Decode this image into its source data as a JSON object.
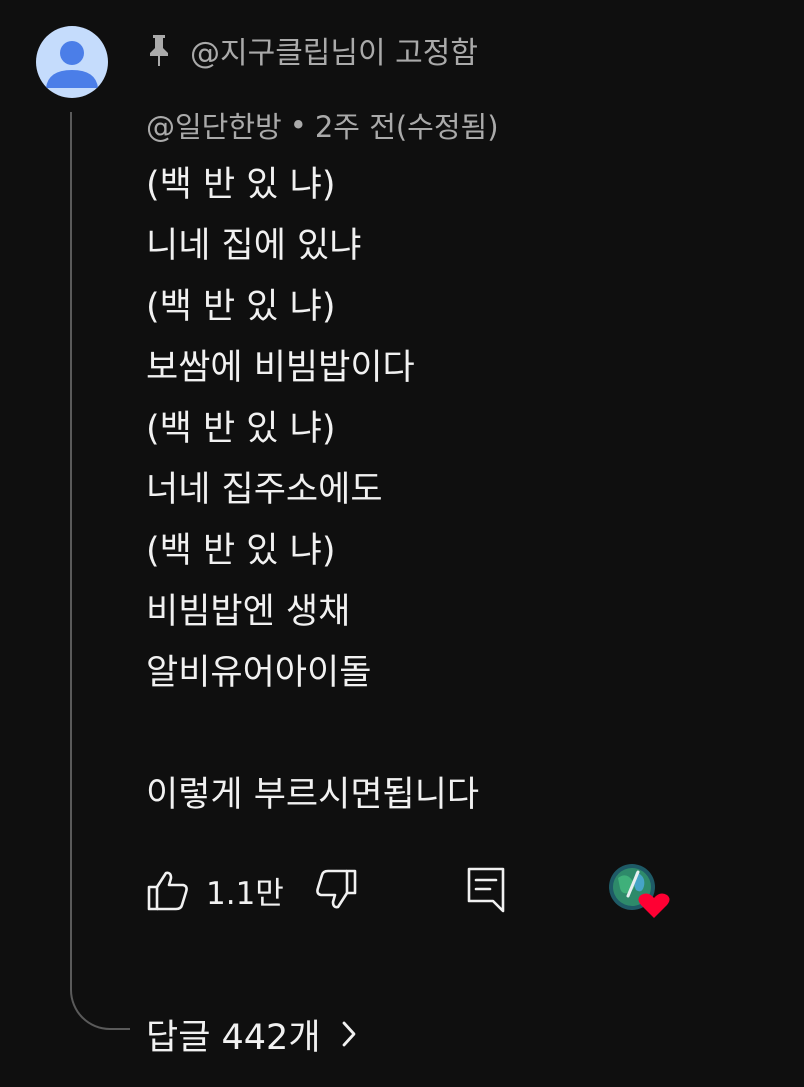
{
  "pinned": {
    "icon": "pin-icon",
    "text": "@지구클립님이 고정함"
  },
  "comment": {
    "author": "@일단한방",
    "separator": "•",
    "time": "2주 전(수정됨)",
    "lines": [
      "(백 반 있 냐)",
      "니네 집에 있냐",
      "(백 반 있 냐)",
      "보쌈에 비빔밥이다",
      "(백 반 있 냐)",
      "너네 집주소에도",
      "(백 반 있 냐)",
      "비빔밥엔 생채",
      "알비유어아이돌",
      "",
      "이렇게 부르시면됩니다"
    ]
  },
  "actions": {
    "like_icon": "thumbs-up-icon",
    "like_count": "1.1만",
    "dislike_icon": "thumbs-down-icon",
    "reply_icon": "reply-comment-icon",
    "creator_heart": "creator-heart-badge"
  },
  "replies": {
    "label": "답글 442개",
    "icon": "chevron-right-icon"
  },
  "colors": {
    "background": "#0f0f0f",
    "text": "#f1f1f1",
    "meta": "#aaaaaa",
    "heart": "#ff0033",
    "avatar_bg": "#c5dcfc",
    "avatar_fg": "#4b7ee8"
  }
}
